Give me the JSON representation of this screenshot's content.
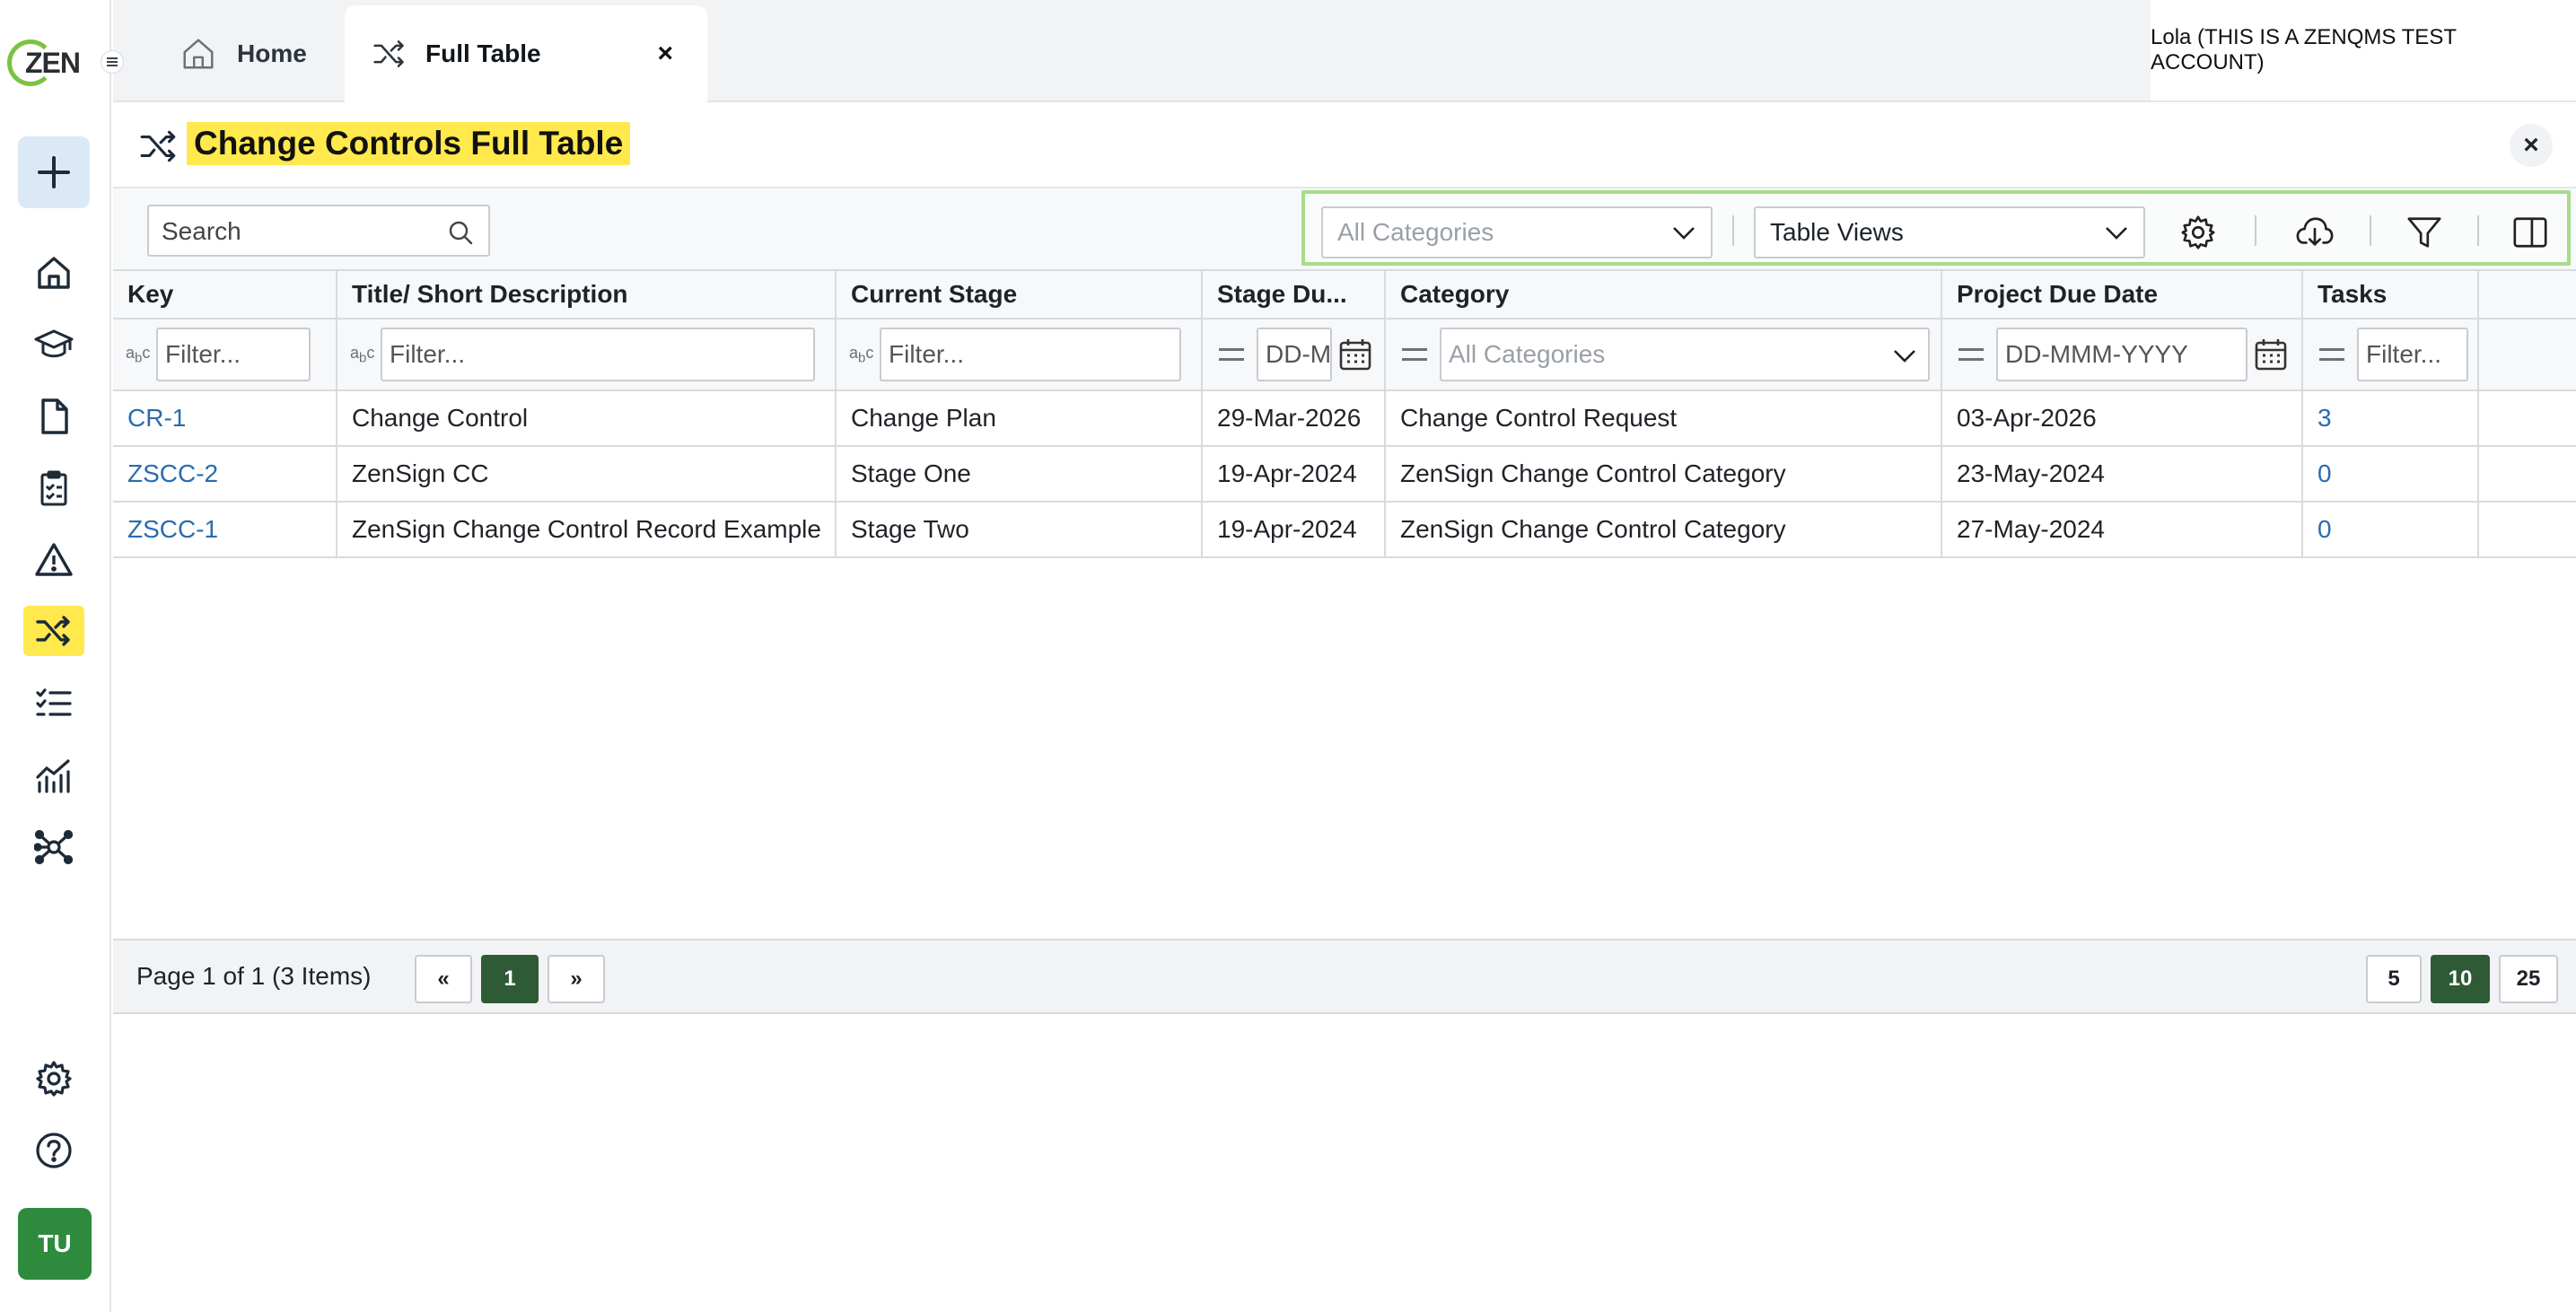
{
  "brand": {
    "logo_text": "ZEN"
  },
  "sidebar": {
    "items": [
      {
        "name": "home"
      },
      {
        "name": "training"
      },
      {
        "name": "documents"
      },
      {
        "name": "checklist"
      },
      {
        "name": "warning"
      },
      {
        "name": "change-controls",
        "active": true
      },
      {
        "name": "tasks"
      },
      {
        "name": "analytics"
      },
      {
        "name": "network"
      }
    ],
    "avatar_initials": "TU"
  },
  "tabs": [
    {
      "label": "Home",
      "icon": "home-icon"
    },
    {
      "label": "Full Table",
      "icon": "shuffle-icon",
      "active": true,
      "close": "×"
    }
  ],
  "account": {
    "label": "Lola (THIS IS A ZENQMS TEST ACCOUNT)"
  },
  "page": {
    "title": "Change Controls Full Table",
    "close": "×"
  },
  "toolbar": {
    "search_placeholder": "Search",
    "category_select": "All Categories",
    "views_select": "Table Views",
    "accent_outline": "#a6dc8a"
  },
  "table": {
    "columns": [
      "Key",
      "Title/ Short Description",
      "Current Stage",
      "Stage Du...",
      "Category",
      "Project Due Date",
      "Tasks"
    ],
    "filters": {
      "text_placeholder": "Filter...",
      "stage_due_placeholder": "DD-MMM-YYYY",
      "category_placeholder": "All Categories",
      "due_date_placeholder": "DD-MMM-YYYY",
      "tasks_placeholder": "Filter..."
    },
    "rows": [
      [
        "CR-1",
        "Change Control",
        "Change Plan",
        "29-Mar-2026",
        "Change Control Request",
        "03-Apr-2026",
        "3"
      ],
      [
        "ZSCC-2",
        "ZenSign CC",
        "Stage One",
        "19-Apr-2024",
        "ZenSign Change Control Category",
        "23-May-2024",
        "0"
      ],
      [
        "ZSCC-1",
        "ZenSign Change Control Record Example",
        "Stage Two",
        "19-Apr-2024",
        "ZenSign Change Control Category",
        "27-May-2024",
        "0"
      ]
    ]
  },
  "pager": {
    "info": "Page 1 of 1 (3 Items)",
    "prev": "«",
    "current": "1",
    "next": "»",
    "sizes": [
      "5",
      "10",
      "25"
    ],
    "active_size": "10"
  },
  "colors": {
    "highlight": "#ffe94d",
    "link": "#2a6bb0",
    "pager_active": "#2f5a36"
  }
}
